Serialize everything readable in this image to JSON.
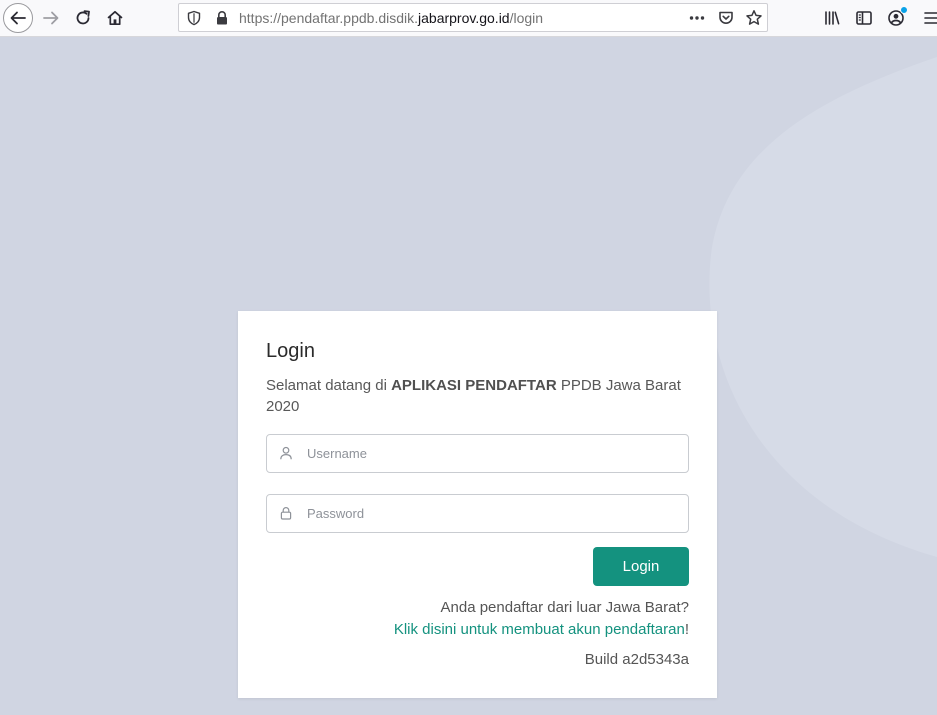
{
  "browser": {
    "url_prefix": "https://pendaftar.ppdb.disdik.",
    "url_domain": "jabarprov.go.id",
    "url_suffix": "/login",
    "icons": {
      "back": "back-arrow-icon",
      "forward": "forward-arrow-icon",
      "reload": "reload-icon",
      "home": "home-icon",
      "shield": "tracking-shield-icon",
      "lock": "lock-icon",
      "more": "more-actions-icon",
      "pocket": "pocket-icon",
      "bookmark": "bookmark-star-icon",
      "library": "library-icon",
      "sidebar": "sidebar-icon",
      "account": "account-icon",
      "menu": "hamburger-menu-icon"
    },
    "badge_color": "#0aa2e8"
  },
  "login_card": {
    "title": "Login",
    "welcome_prefix": "Selamat datang di ",
    "welcome_bold": "APLIKASI PENDAFTAR",
    "welcome_suffix": " PPDB Jawa Barat 2020",
    "username_placeholder": "Username",
    "password_placeholder": "Password",
    "login_button": "Login",
    "external_question": "Anda pendaftar dari luar Jawa Barat?",
    "external_link": "Klik disini untuk membuat akun pendaftaran",
    "external_link_end": "!",
    "build": "Build a2d5343a"
  },
  "colors": {
    "accent": "#14927f",
    "background": "#d0d5e2"
  }
}
